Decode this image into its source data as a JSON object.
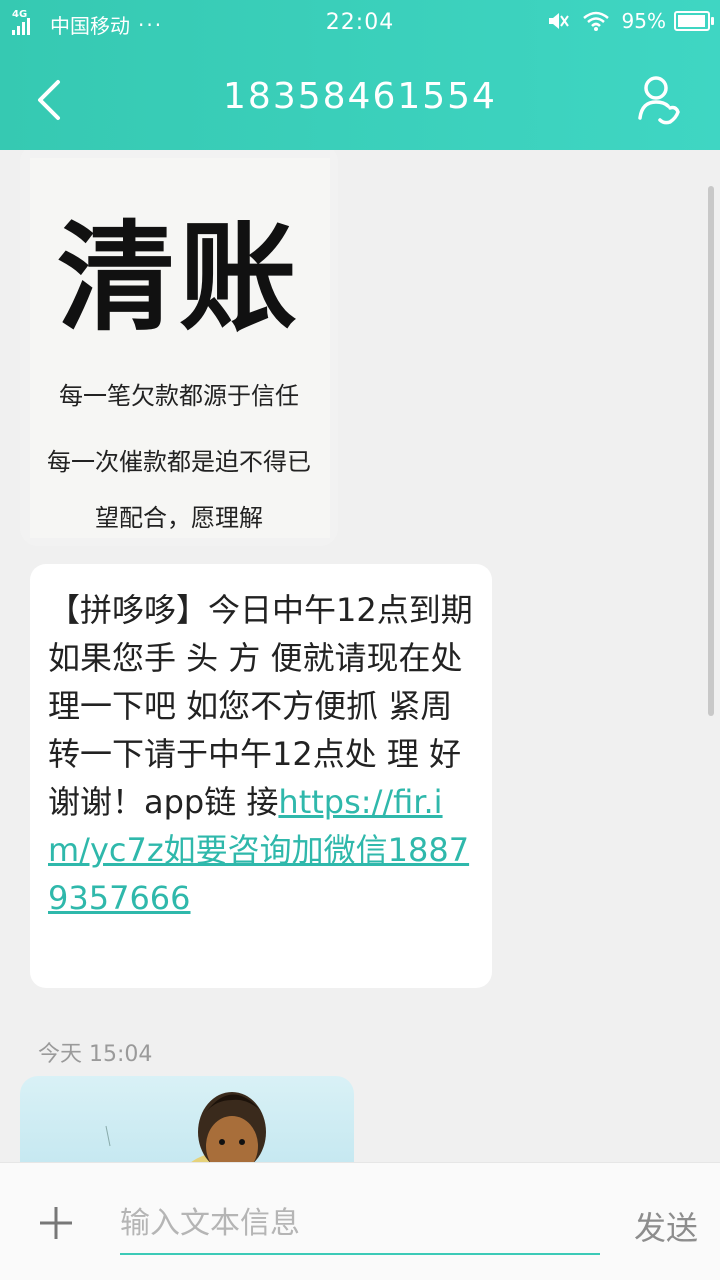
{
  "status_bar": {
    "network": "4G",
    "carrier": "中国移动",
    "carrier_more": "···",
    "time": "22:04",
    "battery": "95%",
    "battery_level": 0.95
  },
  "header": {
    "title": "18358461554",
    "back_icon": "chevron-left-icon",
    "contact_icon": "contact-call-icon"
  },
  "messages": {
    "image1": {
      "title": "清账",
      "line1": "每一笔欠款都源于信任",
      "line2": "每一次催款都是迫不得已",
      "line3": "望配合，愿理解"
    },
    "text": {
      "body": "【拼哆哆】今日中午12点到期如果您手 头 方 便就请现在处 理一下吧 如您不方便抓 紧周转一下请于中午12点处 理 好谢谢！app链 接",
      "link": "https://fir.im/yc7z如要咨询加微信18879357666"
    },
    "timestamp": "今天  15:04"
  },
  "composer": {
    "add_icon": "plus-icon",
    "placeholder": "输入文本信息",
    "send_label": "发送"
  },
  "colors": {
    "accent": "#3ccab7",
    "link": "#2fb8ab",
    "header_bg": "#3bd0bb"
  }
}
